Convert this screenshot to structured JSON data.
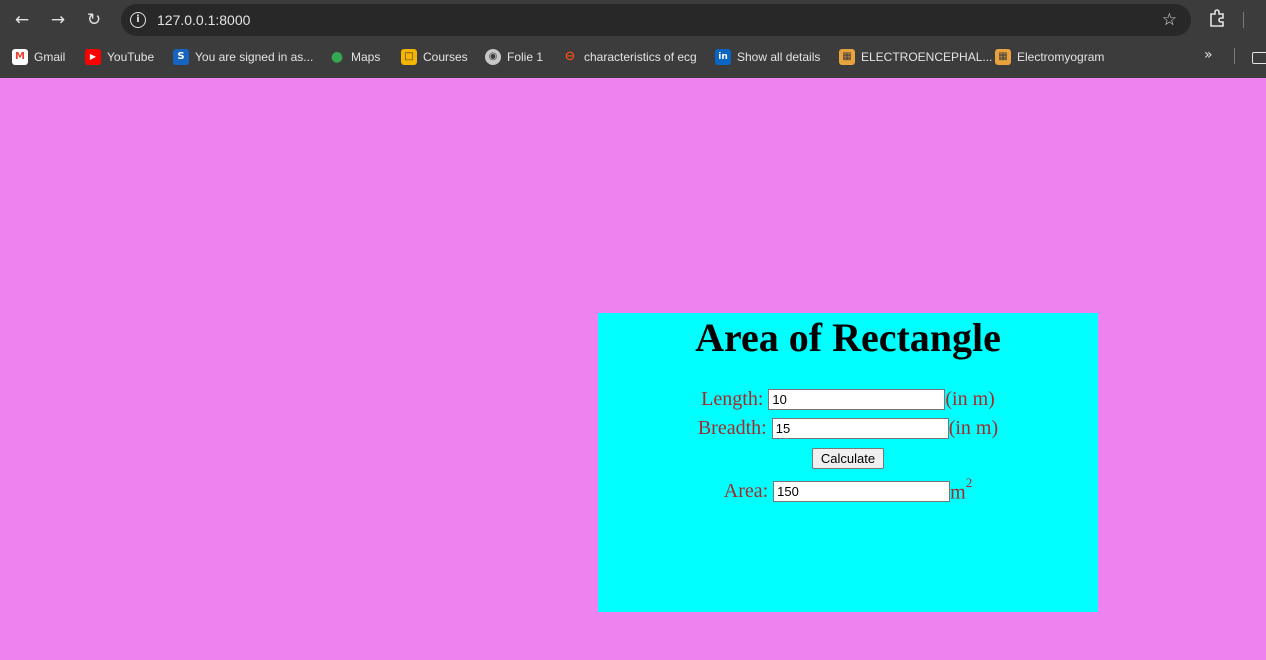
{
  "browser": {
    "url": "127.0.0.1:8000",
    "bookmarks": [
      {
        "label": "Gmail",
        "icon": "gmail-icon"
      },
      {
        "label": "YouTube",
        "icon": "youtube-icon"
      },
      {
        "label": "You are signed in as...",
        "icon": "s-icon"
      },
      {
        "label": "Maps",
        "icon": "maps-icon"
      },
      {
        "label": "Courses",
        "icon": "courses-icon"
      },
      {
        "label": "Folie 1",
        "icon": "globe-icon"
      },
      {
        "label": "characteristics of ecg",
        "icon": "ecg-icon"
      },
      {
        "label": "Show all details",
        "icon": "linkedin-icon"
      },
      {
        "label": "ELECTROENCEPHAL...",
        "icon": "doc-icon"
      },
      {
        "label": "Electromyogram",
        "icon": "doc-icon"
      }
    ]
  },
  "page": {
    "title": "Area of Rectangle",
    "length_label": "Length:",
    "length_value": "10",
    "length_unit": "(in m)",
    "breadth_label": "Breadth:",
    "breadth_value": "15",
    "breadth_unit": "(in m)",
    "calculate_label": "Calculate",
    "area_label": "Area:",
    "area_value": "150",
    "area_unit": "m",
    "area_unit_exponent": "2"
  },
  "colors": {
    "page_background": "#ee82ee",
    "card_background": "#00ffff",
    "label_color": "#a52a2a"
  }
}
